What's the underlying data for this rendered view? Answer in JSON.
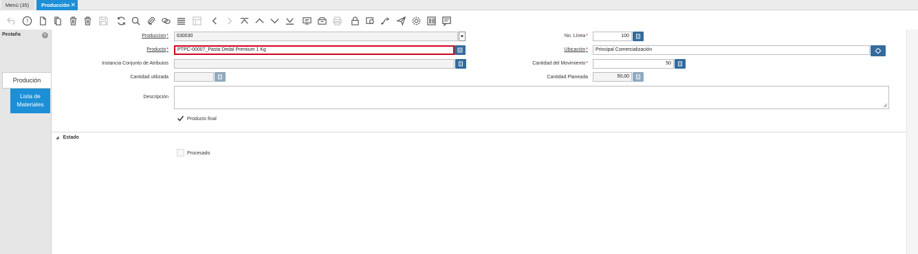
{
  "tabs": {
    "menu_label": "Menú (35)",
    "active_label": "Producción",
    "close_symbol": "✕"
  },
  "toolbar": {
    "icons": [
      "undo-icon",
      "help-icon",
      "new-record-icon",
      "copy-record-icon",
      "delete-icon",
      "delete-selection-icon",
      "save-icon",
      "refresh-icon",
      "find-icon",
      "attachment-icon",
      "chat-icon",
      "grid-toggle-icon",
      "detail-icon",
      "previous-record-icon",
      "next-record-icon",
      "first-record-icon",
      "parent-record-icon",
      "next-down-icon",
      "last-record-icon",
      "report-icon",
      "archive-icon",
      "print-icon",
      "lock-icon",
      "zoom-across-icon",
      "workflow-icon",
      "send-icon",
      "process-icon",
      "product-info-icon",
      "request-icon"
    ]
  },
  "side_panel": {
    "title": "Pestaña",
    "collapse_symbol": "«",
    "tabs": [
      {
        "label": "Produción"
      },
      {
        "label": "Lista de Materiales"
      }
    ]
  },
  "form": {
    "produccion": {
      "label": "Produccion",
      "value": "630030"
    },
    "producto": {
      "label": "Producto",
      "value": "PTPC-00007_Pasta Dedal Premium 1 Kg"
    },
    "instancia": {
      "label": "Instancia Conjunto de Atributos",
      "value": ""
    },
    "cantidad_utilizada": {
      "label": "Cantidad utilizada",
      "value": ""
    },
    "descripcion": {
      "label": "Descripción",
      "value": ""
    },
    "producto_final": {
      "label": "Producto final",
      "checked": true
    },
    "no_linea": {
      "label": "No. Línea",
      "value": "100"
    },
    "ubicacion": {
      "label": "Ubicación",
      "value": "Principal Comercialización"
    },
    "cantidad_movimiento": {
      "label": "Cantidad del Movimiento",
      "value": "50"
    },
    "cantidad_planeada": {
      "label": "Cantidad Planeada",
      "value": "50,00"
    }
  },
  "estado_section": {
    "title": "Estado",
    "procesado": {
      "label": "Procesado",
      "checked": false
    }
  },
  "colors": {
    "accent": "#1d8fd6",
    "button": "#336b9d",
    "required": "#d0021b"
  }
}
